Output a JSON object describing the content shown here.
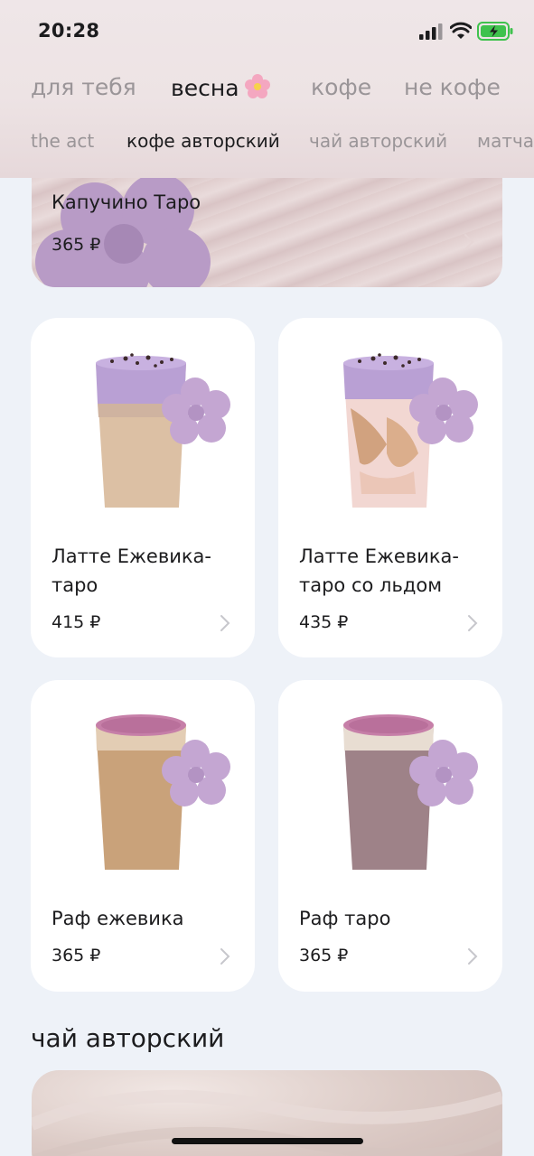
{
  "status_bar": {
    "time": "20:28"
  },
  "category_tabs": [
    {
      "label": "для тебя",
      "active": false
    },
    {
      "label": "весна",
      "active": true,
      "icon": "cherry-blossom-icon"
    },
    {
      "label": "кофе",
      "active": false
    },
    {
      "label": "не кофе",
      "active": false
    }
  ],
  "sub_tabs": [
    {
      "label": "the act",
      "active": false
    },
    {
      "label": "кофе авторский",
      "active": true
    },
    {
      "label": "чай авторский",
      "active": false
    },
    {
      "label": "матча",
      "active": false
    }
  ],
  "hero_item": {
    "name": "Капучино Таро",
    "price": "365 ₽"
  },
  "products": [
    {
      "name": "Латте Ежевика-таро",
      "price": "415 ₽"
    },
    {
      "name": "Латте Ежевика-таро со льдом",
      "price": "435 ₽"
    },
    {
      "name": "Раф ежевика",
      "price": "365 ₽"
    },
    {
      "name": "Раф таро",
      "price": "365 ₽"
    }
  ],
  "next_section": {
    "title": "чай авторский"
  },
  "colors": {
    "background": "#eef2f8",
    "card": "#ffffff",
    "taro_purple": "#b9a0d4",
    "flower": "#c7a8d2"
  }
}
